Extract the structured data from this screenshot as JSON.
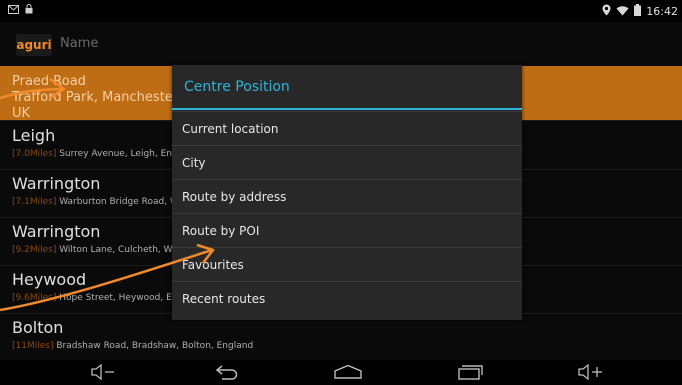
{
  "status_bar": {
    "time": "16:42",
    "icons_left": [
      "mail-icon",
      "lock-icon"
    ],
    "icons_right": [
      "location-icon",
      "wifi-icon",
      "battery-icon"
    ]
  },
  "header": {
    "logo_text": "aguri",
    "sort_label": "Name"
  },
  "list": {
    "items": [
      {
        "title": "Praed Road",
        "line2": "Trafford Park, Manchester",
        "line3": "UK",
        "selected": true
      },
      {
        "title": "Leigh",
        "miles": "[7.0Miles]",
        "address": "Surrey Avenue, Leigh, Eng"
      },
      {
        "title": "Warrington",
        "miles": "[7.1Miles]",
        "address": "Warburton Bridge Road, W"
      },
      {
        "title": "Warrington",
        "miles": "[9.2Miles]",
        "address": "Wilton Lane, Culcheth, W"
      },
      {
        "title": "Heywood",
        "miles": "[9.6Miles]",
        "address": "Hope Street, Heywood, En"
      },
      {
        "title": "Bolton",
        "miles": "[11Miles]",
        "address": "Bradshaw Road, Bradshaw, Bolton, England"
      }
    ]
  },
  "dialog": {
    "title": "Centre Position",
    "options": [
      "Current location",
      "City",
      "Route by address",
      "Route by POI",
      "Favourites",
      "Recent routes"
    ]
  },
  "nav_bar": {
    "buttons": [
      "volume-down-icon",
      "back-icon",
      "home-icon",
      "recent-apps-icon",
      "volume-up-icon"
    ]
  },
  "colors": {
    "accent": "#2fb3dd",
    "highlight": "#bf6d14",
    "annotation_arrow": "#f08a2a",
    "background_frame": "#f5dcc4"
  }
}
